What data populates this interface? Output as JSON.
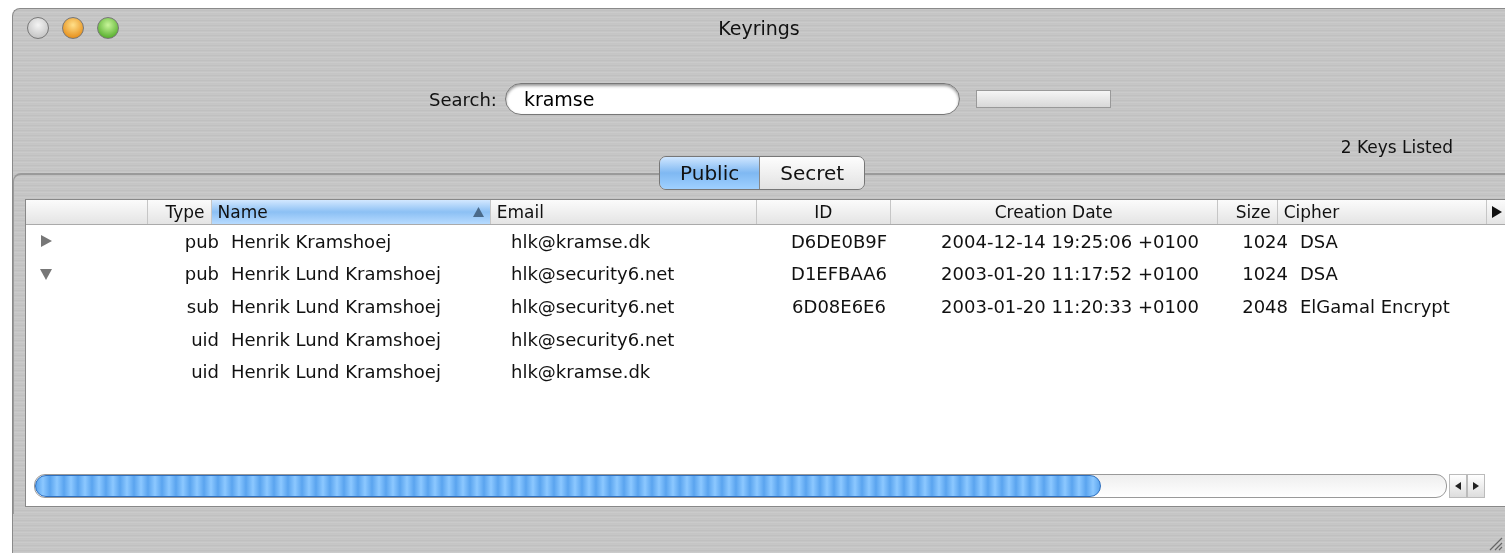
{
  "window": {
    "title": "Keyrings"
  },
  "search": {
    "label": "Search:",
    "value": "kramse"
  },
  "tabs": [
    {
      "label": "Public",
      "selected": true
    },
    {
      "label": "Secret",
      "selected": false
    }
  ],
  "count": "2  Keys Listed",
  "table": {
    "columns": [
      {
        "label": "Type",
        "sorted": false
      },
      {
        "label": "Name",
        "sorted": true
      },
      {
        "label": "Email",
        "sorted": false
      },
      {
        "label": "ID",
        "sorted": false
      },
      {
        "label": "Creation Date",
        "sorted": false
      },
      {
        "label": "Size",
        "sorted": false
      },
      {
        "label": "Cipher",
        "sorted": false
      }
    ],
    "rows": [
      {
        "expanded": false,
        "cells": [
          "pub",
          "Henrik Kramshoej",
          "hlk@kramse.dk",
          "D6DE0B9F",
          "2004-12-14 19:25:06 +0100",
          "1024",
          "DSA"
        ]
      },
      {
        "expanded": true,
        "cells": [
          "pub",
          "Henrik Lund Kramshoej",
          "hlk@security6.net",
          "D1EFBAA6",
          "2003-01-20 11:17:52 +0100",
          "1024",
          "DSA"
        ]
      },
      {
        "cells": [
          "sub",
          "Henrik Lund Kramshoej",
          "hlk@security6.net",
          "6D08E6E6",
          "2003-01-20 11:20:33 +0100",
          "2048",
          "ElGamal Encrypt"
        ]
      },
      {
        "cells": [
          "uid",
          "Henrik Lund Kramshoej",
          "hlk@security6.net"
        ]
      },
      {
        "cells": [
          "uid",
          "Henrik Lund Kramshoej",
          "hlk@kramse.dk"
        ]
      }
    ]
  }
}
